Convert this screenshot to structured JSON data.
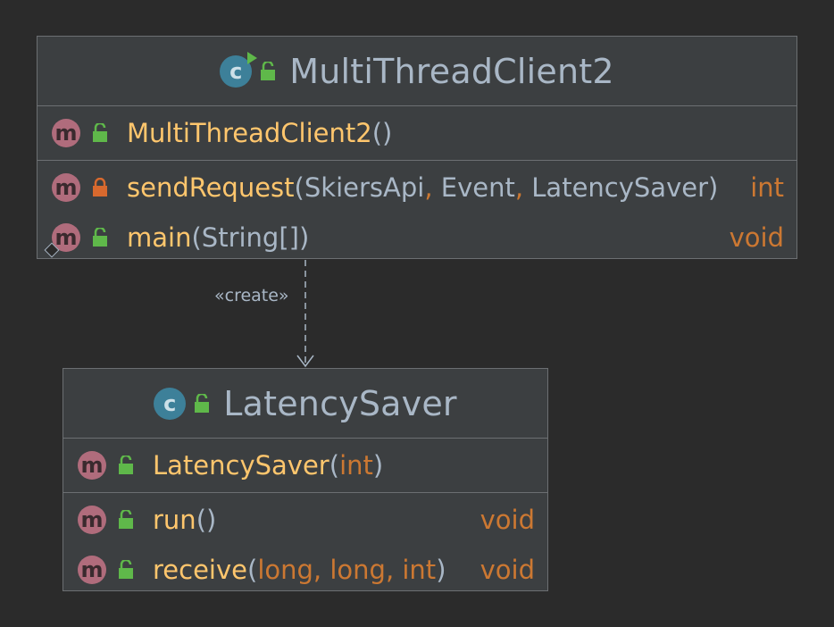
{
  "classes": {
    "multithread": {
      "name": "MultiThreadClient2",
      "constructors": [
        {
          "name": "MultiThreadClient2",
          "params": [],
          "return": ""
        }
      ],
      "methods": [
        {
          "name": "sendRequest",
          "params": [
            {
              "type": "SkiersApi",
              "primitive": false
            },
            {
              "type": "Event",
              "primitive": false
            },
            {
              "type": "LatencySaver",
              "primitive": false
            }
          ],
          "return": "int",
          "visibility": "private"
        },
        {
          "name": "main",
          "params": [
            {
              "type": "String[]",
              "primitive": false
            }
          ],
          "return": "void",
          "visibility": "public",
          "entry_point": true
        }
      ]
    },
    "latency": {
      "name": "LatencySaver",
      "constructors": [
        {
          "name": "LatencySaver",
          "params": [
            {
              "type": "int",
              "primitive": true
            }
          ],
          "return": ""
        }
      ],
      "methods": [
        {
          "name": "run",
          "params": [],
          "return": "void",
          "visibility": "public"
        },
        {
          "name": "receive",
          "params": [
            {
              "type": "long",
              "primitive": true
            },
            {
              "type": "long",
              "primitive": true
            },
            {
              "type": "int",
              "primitive": true
            }
          ],
          "return": "void",
          "visibility": "public"
        }
      ]
    }
  },
  "relation": {
    "label": "«create»"
  },
  "icons": {
    "class": "class-icon",
    "method": "method-icon",
    "public": "unlocked-padlock-icon",
    "private": "locked-padlock-icon",
    "runnable": "run-arrow-icon",
    "entry": "entry-point-icon"
  },
  "colors": {
    "background": "#2b2b2b",
    "class_fill": "#3c3f41",
    "border": "#6c6f72",
    "method_name": "#ffc66d",
    "text": "#a9b7c6",
    "keyword": "#cc7832",
    "method_icon": "#b06c7c",
    "class_icon": "#3d8099",
    "public_icon": "#5fb84a",
    "private_icon": "#d8692e"
  }
}
